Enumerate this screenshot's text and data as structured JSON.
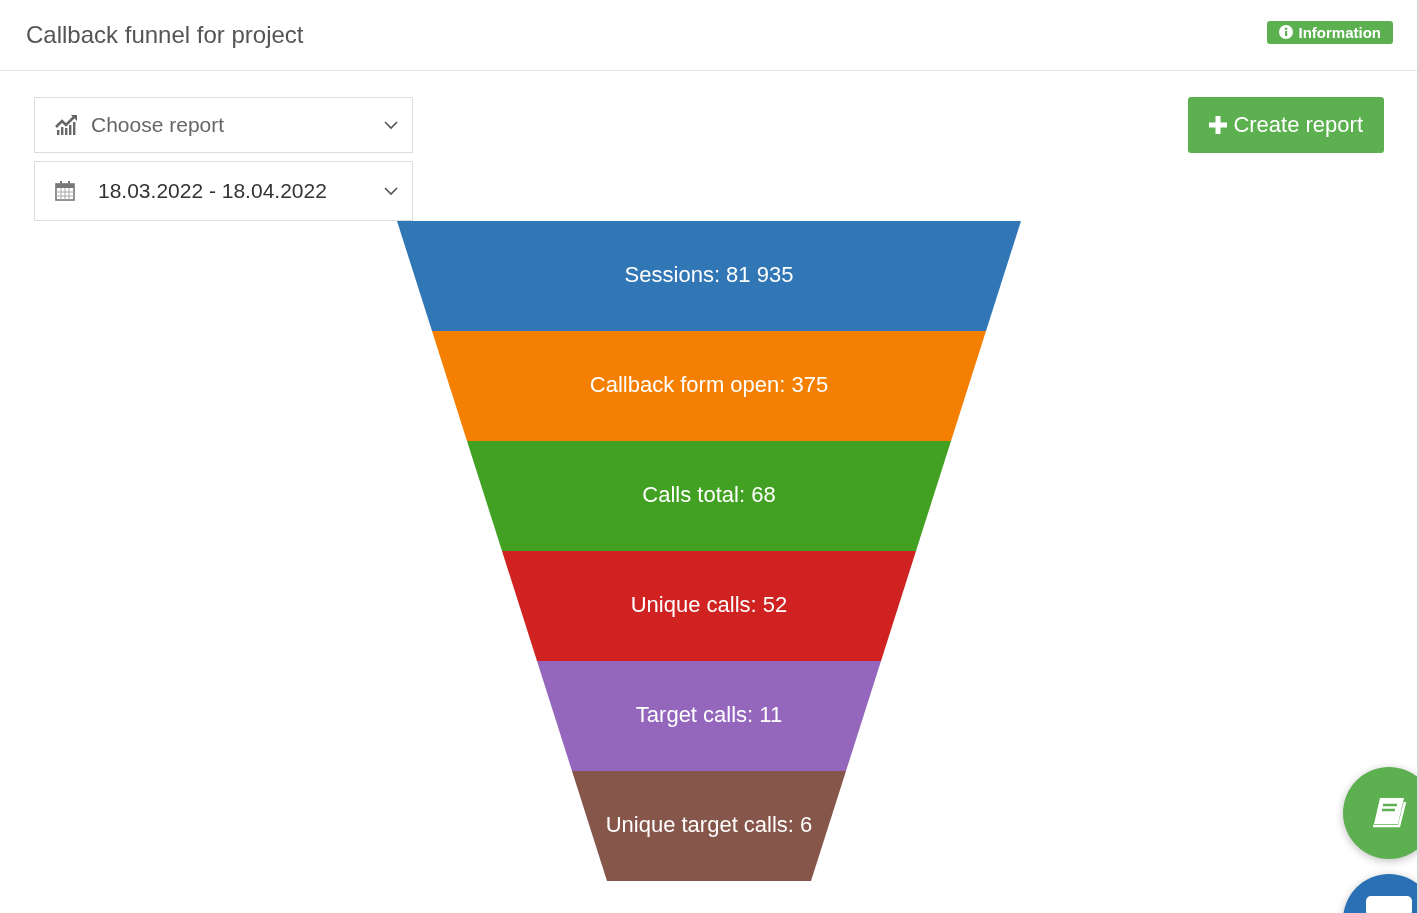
{
  "header": {
    "title": "Callback funnel for project",
    "info_badge": "Information"
  },
  "report_select": {
    "placeholder": "Choose report"
  },
  "date_range": {
    "value": "18.03.2022 - 18.04.2022"
  },
  "create_button": {
    "label": "Create report"
  },
  "funnel": {
    "stages": [
      {
        "label": "Sessions: 81 935",
        "color": "#3177b5"
      },
      {
        "label": "Callback form open: 375",
        "color": "#f57f00"
      },
      {
        "label": "Calls total: 68",
        "color": "#42a123"
      },
      {
        "label": "Unique calls: 52",
        "color": "#cf2221"
      },
      {
        "label": "Target calls: 11",
        "color": "#9467bd"
      },
      {
        "label": "Unique target calls: 6",
        "color": "#87564b"
      }
    ]
  }
}
